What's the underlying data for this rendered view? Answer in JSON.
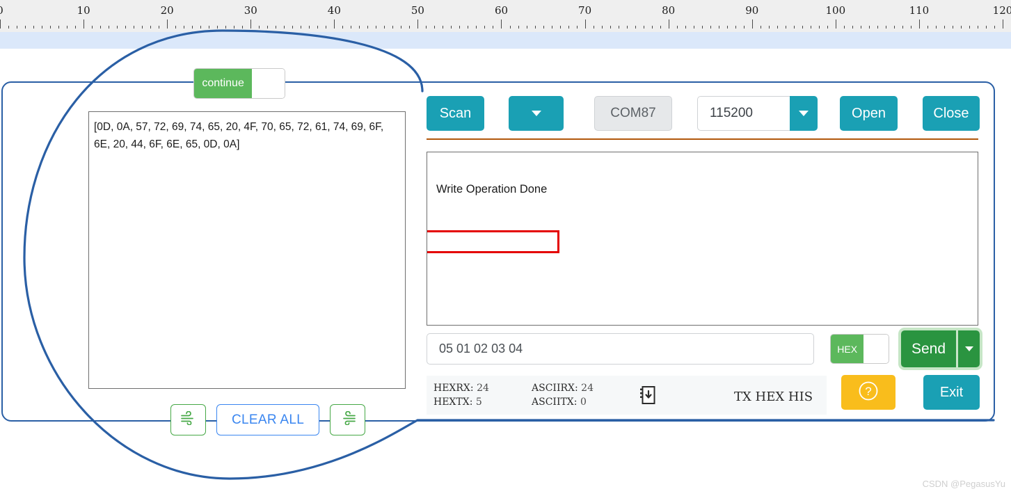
{
  "ruler": {
    "unit_labels": [
      "0",
      "10",
      "20",
      "30",
      "40",
      "50",
      "60",
      "70",
      "80",
      "90",
      "100",
      "110",
      "120"
    ],
    "max": 120
  },
  "left_panel": {
    "continue_toggle": {
      "label": "continue",
      "state": "on"
    },
    "receive_text": "[0D, 0A, 57, 72, 69, 74, 65, 20, 4F, 70, 65, 72, 61, 74, 69, 6F, 6E, 20, 44, 6F, 6E, 65, 0D, 0A]",
    "buttons": {
      "clear_all": "CLEAR ALL",
      "wind_left_icon": "wind-icon",
      "wind_right_icon": "wind-icon"
    }
  },
  "toolbar": {
    "scan_label": "Scan",
    "scan_dropdown_icon": "chevron-down-icon",
    "port_value": "COM87",
    "baud_value": "115200",
    "baud_dropdown_icon": "chevron-down-icon",
    "open_label": "Open",
    "close_label": "Close"
  },
  "terminal": {
    "received_line": "Write Operation Done",
    "highlight_color": "#e40000"
  },
  "send_row": {
    "input_value": "05 01 02 03 04",
    "hex_toggle": {
      "label": "HEX",
      "state": "on"
    },
    "send_label": "Send",
    "send_dropdown_icon": "chevron-down-icon"
  },
  "status_bar": {
    "hexrx_label": "HEXRX:",
    "hexrx_value": "24",
    "hextx_label": "HEXTX:",
    "hextx_value": "5",
    "asciirx_label": "ASCIIRX:",
    "asciirx_value": "24",
    "asciitx_label": "ASCIITX:",
    "asciitx_value": "0",
    "save_icon": "save-to-file-icon",
    "tx_hex_his_label": "TX HEX HIS"
  },
  "footer_buttons": {
    "help_icon": "question-circle-icon",
    "exit_label": "Exit"
  },
  "watermark": "CSDN @PegasusYu",
  "colors": {
    "teal": "#1aa0b4",
    "green": "#2a9440",
    "toggle_green": "#5cb85c",
    "blue_link": "#3a86f0",
    "yellow": "#f9bd1c",
    "annotation_blue": "#2a5fa5",
    "annotation_red": "#e40000",
    "divider_brown": "#b1570c"
  }
}
